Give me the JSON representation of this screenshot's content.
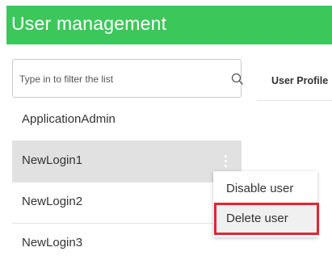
{
  "header": {
    "title": "User management",
    "accent_color": "#3cc75b"
  },
  "search": {
    "placeholder": "Type in to filter the list",
    "value": "",
    "icon": "search-icon"
  },
  "tabs": [
    {
      "label": "User Profile"
    }
  ],
  "user_list": {
    "items": [
      {
        "label": "ApplicationAdmin",
        "selected": false
      },
      {
        "label": "NewLogin1",
        "selected": true,
        "icon": "kebab-menu-icon"
      },
      {
        "label": "NewLogin2",
        "selected": false
      },
      {
        "label": "NewLogin3",
        "selected": false
      }
    ]
  },
  "context_menu": {
    "items": [
      {
        "label": "Disable user"
      },
      {
        "label": "Delete user",
        "highlighted": true,
        "highlight_color": "#e0262f"
      }
    ]
  }
}
